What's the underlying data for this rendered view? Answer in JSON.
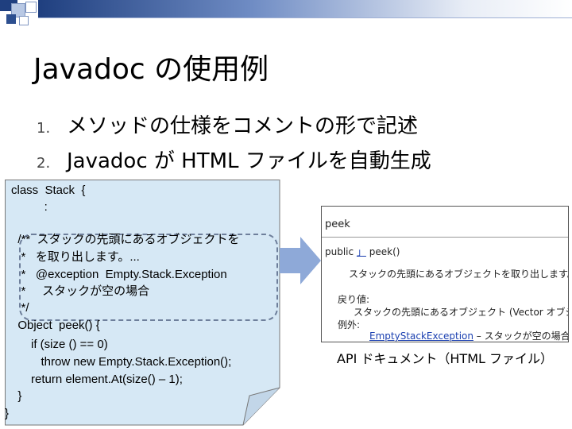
{
  "slide": {
    "title": "Javadoc の使用例",
    "list": [
      {
        "num": "1.",
        "text": "メソッドの仕様をコメントの形で記述"
      },
      {
        "num": "2.",
        "text": "Javadoc が HTML ファイルを自動生成"
      }
    ]
  },
  "code": {
    "lines": [
      "class  Stack  {",
      "          :",
      "",
      "  /**  スタックの先頭にあるオブジェクトを",
      "   *   を取り出します。...",
      "   *   @exception  Empty.Stack.Exception",
      "   *     スタックが空の場合",
      "   */",
      "  Object  peek() {",
      "      if (size () == 0)",
      "         throw new Empty.Stack.Exception();",
      "      return element.At(size() – 1);",
      "  }",
      "}"
    ]
  },
  "api_doc": {
    "heading": "peek",
    "signature_prefix": "public",
    "signature_link": "」",
    "signature_rest": "peek()",
    "description": "スタックの先頭にあるオブジェクトを取り出します。この",
    "returns_label": "戻り値:",
    "returns_text": "スタックの先頭にあるオブジェクト (Vector オブジ",
    "throws_label": "例外:",
    "throws_link": "EmptyStackException",
    "throws_text": " – スタックが空の場合",
    "caption": "API ドキュメント（HTML ファイル）"
  },
  "colors": {
    "note_fill": "#d6e8f5",
    "dash_border": "#6e7f9b",
    "arrow": "#8ea9d8",
    "link": "#1a3fb0"
  }
}
